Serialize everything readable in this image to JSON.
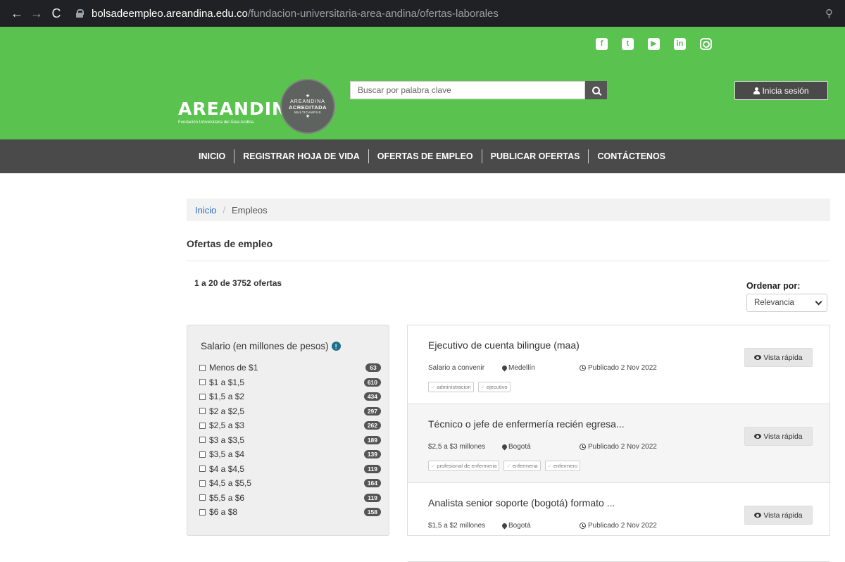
{
  "browser": {
    "url_host": "bolsadeempleo.areandina.edu.co",
    "url_path": "/fundacion-universitaria-area-andina/ofertas-laborales"
  },
  "header": {
    "logo_text": "AREANDINA",
    "logo_sub": "Fundación Universitaria del Área Andina",
    "seal_line1": "AREANDINA",
    "seal_line2": "ACREDITADA",
    "seal_line3": "MULTICAMPUS",
    "search_placeholder": "Buscar por palabra clave",
    "login_label": "Inicia sesión",
    "social_icons": [
      "facebook-icon",
      "twitter-icon",
      "youtube-icon",
      "linkedin-icon",
      "instagram-icon"
    ],
    "brand_color": "#5ac24f"
  },
  "nav": {
    "items": [
      "INICIO",
      "REGISTRAR HOJA DE VIDA",
      "OFERTAS DE EMPLEO",
      "PUBLICAR OFERTAS",
      "CONTÁCTENOS"
    ]
  },
  "breadcrumb": {
    "home": "Inicio",
    "current": "Empleos"
  },
  "page": {
    "title": "Ofertas de empleo",
    "results": "1 a 20 de 3752 ofertas",
    "sort_label": "Ordenar por:",
    "sort_value": "Relevancia"
  },
  "filter": {
    "title": "Salario (en millones de pesos)",
    "items": [
      {
        "label": "Menos de $1",
        "count": "63"
      },
      {
        "label": "$1 a $1,5",
        "count": "610"
      },
      {
        "label": "$1,5 a $2",
        "count": "434"
      },
      {
        "label": "$2 a $2,5",
        "count": "297"
      },
      {
        "label": "$2,5 a $3",
        "count": "262"
      },
      {
        "label": "$3 a $3,5",
        "count": "189"
      },
      {
        "label": "$3,5 a $4",
        "count": "139"
      },
      {
        "label": "$4 a $4,5",
        "count": "119"
      },
      {
        "label": "$4,5 a $5,5",
        "count": "164"
      },
      {
        "label": "$5,5 a $6",
        "count": "119"
      },
      {
        "label": "$6 a $8",
        "count": "158"
      }
    ]
  },
  "jobs": [
    {
      "title": "Ejecutivo de cuenta bilingue (maa)",
      "salary": "Salario a convenir",
      "location": "Medellín",
      "published": "Publicado 2 Nov 2022",
      "tags": [
        "administracion",
        "ejecutivo"
      ],
      "quick_view": "Vista rápida"
    },
    {
      "title": "Técnico o jefe de enfermería recién egresa...",
      "salary": "$2,5 a $3 millones",
      "location": "Bogotá",
      "published": "Publicado 2 Nov 2022",
      "tags": [
        "profesional de enfermeria",
        "enfermeria",
        "enfermero"
      ],
      "quick_view": "Vista rápida"
    },
    {
      "title": "Analista senior soporte (bogotá) formato ...",
      "salary": "$1,5 a $2 millones",
      "location": "Bogotá",
      "published": "Publicado 2 Nov 2022",
      "tags": [],
      "quick_view": "Vista rápida"
    }
  ]
}
